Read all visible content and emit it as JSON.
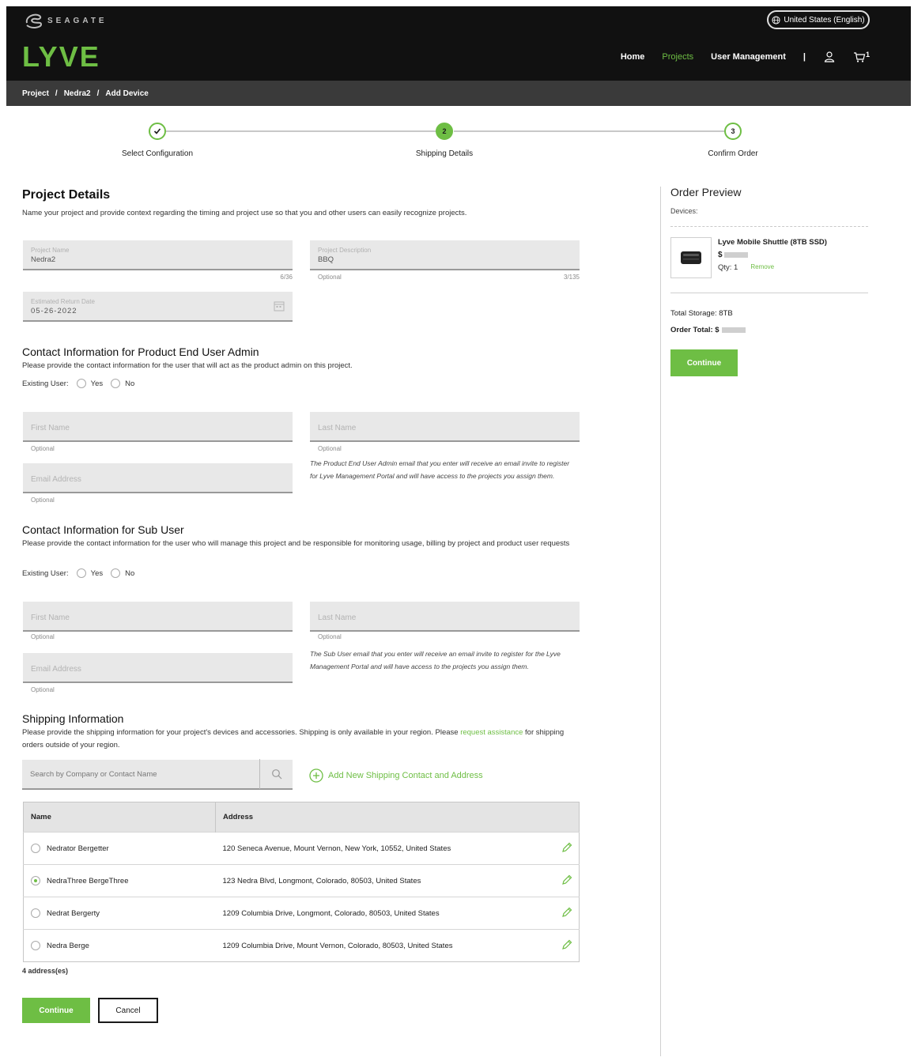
{
  "header": {
    "brand": "SEAGATE",
    "product": "LYVE",
    "language": "United States (English)",
    "nav": [
      {
        "label": "Home",
        "active": false
      },
      {
        "label": "Projects",
        "active": true
      },
      {
        "label": "User Management",
        "active": false
      }
    ],
    "nav_separator": "|",
    "cart_count": "1"
  },
  "breadcrumb": {
    "items": [
      "Project",
      "Nedra2",
      "Add Device"
    ],
    "separator": "/"
  },
  "stepper": {
    "steps": [
      {
        "label": "Select Configuration",
        "number": "1",
        "state": "done"
      },
      {
        "label": "Shipping Details",
        "number": "2",
        "state": "current"
      },
      {
        "label": "Confirm Order",
        "number": "3",
        "state": "todo"
      }
    ]
  },
  "project_details": {
    "title": "Project Details",
    "description": "Name your project and provide context regarding the timing and project use so that you and other users can easily recognize projects.",
    "project_name": {
      "label": "Project Name",
      "value": "Nedra2",
      "counter": "6/36"
    },
    "project_description": {
      "label": "Project Description",
      "value": "BBQ",
      "hint": "Optional",
      "counter": "3/135"
    },
    "return_date": {
      "label": "Estimated Return Date",
      "value": "05-26-2022"
    }
  },
  "end_user_admin": {
    "title": "Contact Information for Product End User Admin",
    "description": "Please provide the contact information for the user that will act as the product admin on this project.",
    "existing_user_label": "Existing User:",
    "yes": "Yes",
    "no": "No",
    "first_name": "First Name",
    "last_name": "Last Name",
    "email": "Email Address",
    "optional": "Optional",
    "note": "The Product End User Admin email that you enter will receive an email invite to register for Lyve Management Portal and will have access to the projects you assign them."
  },
  "sub_user": {
    "title": "Contact Information for Sub User",
    "description": "Please provide the contact information for the user who will manage this project and be responsible for monitoring usage, billing by project and product user requests",
    "existing_user_label": "Existing User:",
    "yes": "Yes",
    "no": "No",
    "first_name": "First Name",
    "last_name": "Last Name",
    "email": "Email Address",
    "optional": "Optional",
    "note": "The Sub User email that you enter will receive an email invite to register for the Lyve Management Portal and will have access to the projects you assign them."
  },
  "shipping": {
    "title": "Shipping Information",
    "description_pre": "Please provide the shipping information for your project's devices and accessories. Shipping is only available in your region. Please ",
    "description_link": "request assistance",
    "description_post": " for shipping orders outside of your region.",
    "search_placeholder": "Search by Company or Contact Name",
    "add_new": "Add New Shipping Contact and Address",
    "columns": [
      "Name",
      "Address"
    ],
    "rows": [
      {
        "name": "Nedrator Bergetter",
        "address": "120 Seneca Avenue, Mount Vernon, New York, 10552, United States",
        "selected": false
      },
      {
        "name": "NedraThree BergeThree",
        "address": "123 Nedra Blvd, Longmont, Colorado, 80503, United States",
        "selected": true
      },
      {
        "name": "Nedrat Bergerty",
        "address": "1209 Columbia Drive, Longmont, Colorado, 80503, United States",
        "selected": false
      },
      {
        "name": "Nedra Berge",
        "address": "1209 Columbia Drive, Mount Vernon, Colorado, 80503, United States",
        "selected": false
      }
    ],
    "count": "4 address(es)"
  },
  "actions": {
    "continue": "Continue",
    "cancel": "Cancel"
  },
  "order_preview": {
    "title": "Order Preview",
    "devices_label": "Devices:",
    "device_name": "Lyve Mobile Shuttle (8TB SSD)",
    "price_prefix": "$",
    "qty": "Qty: 1",
    "remove": "Remove",
    "total_storage": "Total Storage: 8TB",
    "order_total": "Order Total: $",
    "continue": "Continue"
  },
  "colors": {
    "accent": "#6ebe44",
    "header_bg": "#111111",
    "breadcrumb_bg": "#3a3a3a",
    "field_bg": "#e8e8e8"
  }
}
